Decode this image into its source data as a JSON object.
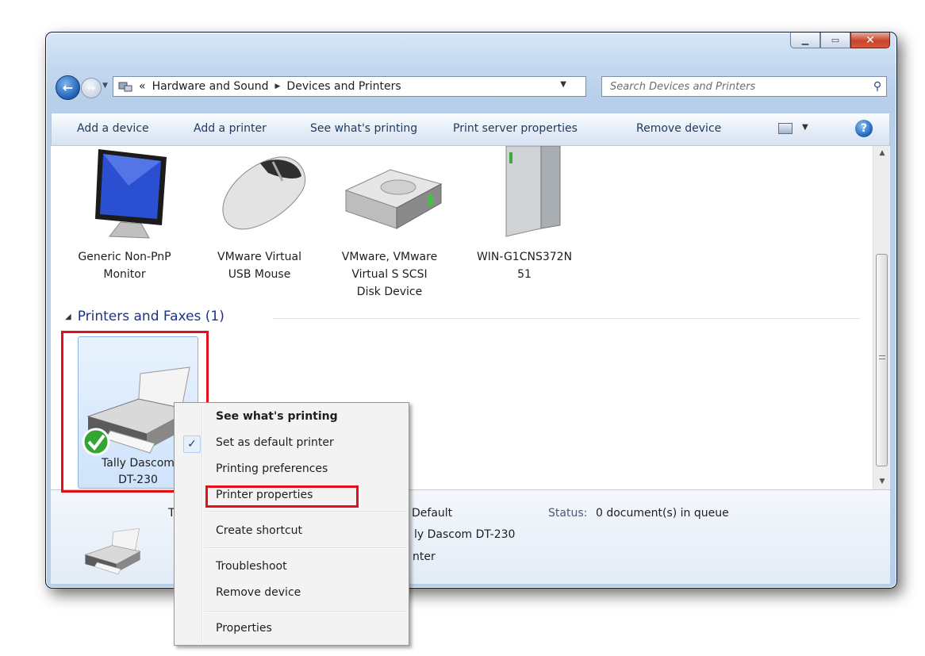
{
  "address": {
    "overflow": "«",
    "segments": [
      "Hardware and Sound",
      "Devices and Printers"
    ]
  },
  "search": {
    "placeholder": "Search Devices and Printers"
  },
  "toolbar": {
    "add_device": "Add a device",
    "add_printer": "Add a printer",
    "see_printing": "See what's printing",
    "print_server": "Print server properties",
    "remove_device": "Remove device"
  },
  "devices": [
    {
      "label_line1": "Generic Non-PnP",
      "label_line2": "Monitor",
      "label_line3": ""
    },
    {
      "label_line1": "VMware Virtual",
      "label_line2": "USB Mouse",
      "label_line3": ""
    },
    {
      "label_line1": "VMware, VMware",
      "label_line2": "Virtual S SCSI",
      "label_line3": "Disk Device"
    },
    {
      "label_line1": "WIN-G1CNS372N",
      "label_line2": "51",
      "label_line3": ""
    }
  ],
  "printers_group": {
    "title": "Printers and Faxes (1)"
  },
  "printer": {
    "label_line1": "Tally Dascom",
    "label_line2": "DT-230"
  },
  "details": {
    "name_partial": "T",
    "state_partial": "Default",
    "model_partial": "ly Dascom DT-230",
    "category_partial": "nter",
    "status_label": "Status:",
    "status_value": "0 document(s) in queue"
  },
  "context_menu": {
    "items": [
      "See what's printing",
      "Set as default printer",
      "Printing preferences",
      "Printer properties",
      "Create shortcut",
      "Troubleshoot",
      "Remove device",
      "Properties"
    ],
    "check_glyph": "✓"
  },
  "colors": {
    "highlight": "#e3101b",
    "link": "#1e3287"
  }
}
